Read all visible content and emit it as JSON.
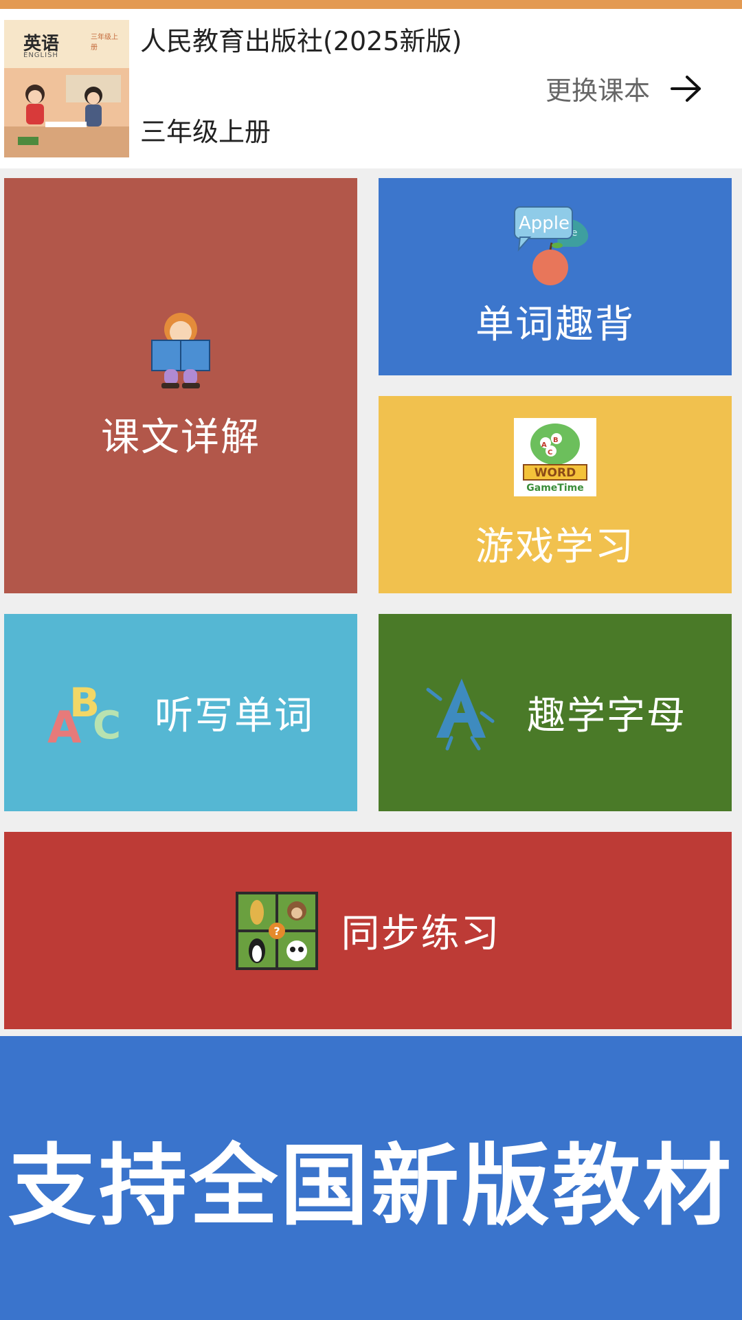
{
  "header": {
    "publisher": "人民教育出版社(2025新版)",
    "grade": "三年级上册",
    "change_label": "更换课本",
    "cover": {
      "title": "英语",
      "subtitle": "ENGLISH",
      "grade_text": "三年级上册"
    }
  },
  "tiles": {
    "kewen": "课文详解",
    "danci": "单词趣背",
    "youxi": "游戏学习",
    "tingxie": "听写单词",
    "zimu": "趣学字母",
    "tongbu": "同步练习"
  },
  "icons": {
    "apple_text": "Apple",
    "word_text": "WORD",
    "gametime_text": "GameTime"
  },
  "banner": {
    "text": "支持全国新版教材"
  },
  "colors": {
    "accent_orange": "#e39a52",
    "kewen": "#b2574a",
    "danci": "#3c76cc",
    "youxi": "#f1c14e",
    "tingxie": "#55b7d3",
    "zimu": "#4a7a28",
    "tongbu": "#bd3b36",
    "banner": "#3a74cc"
  }
}
